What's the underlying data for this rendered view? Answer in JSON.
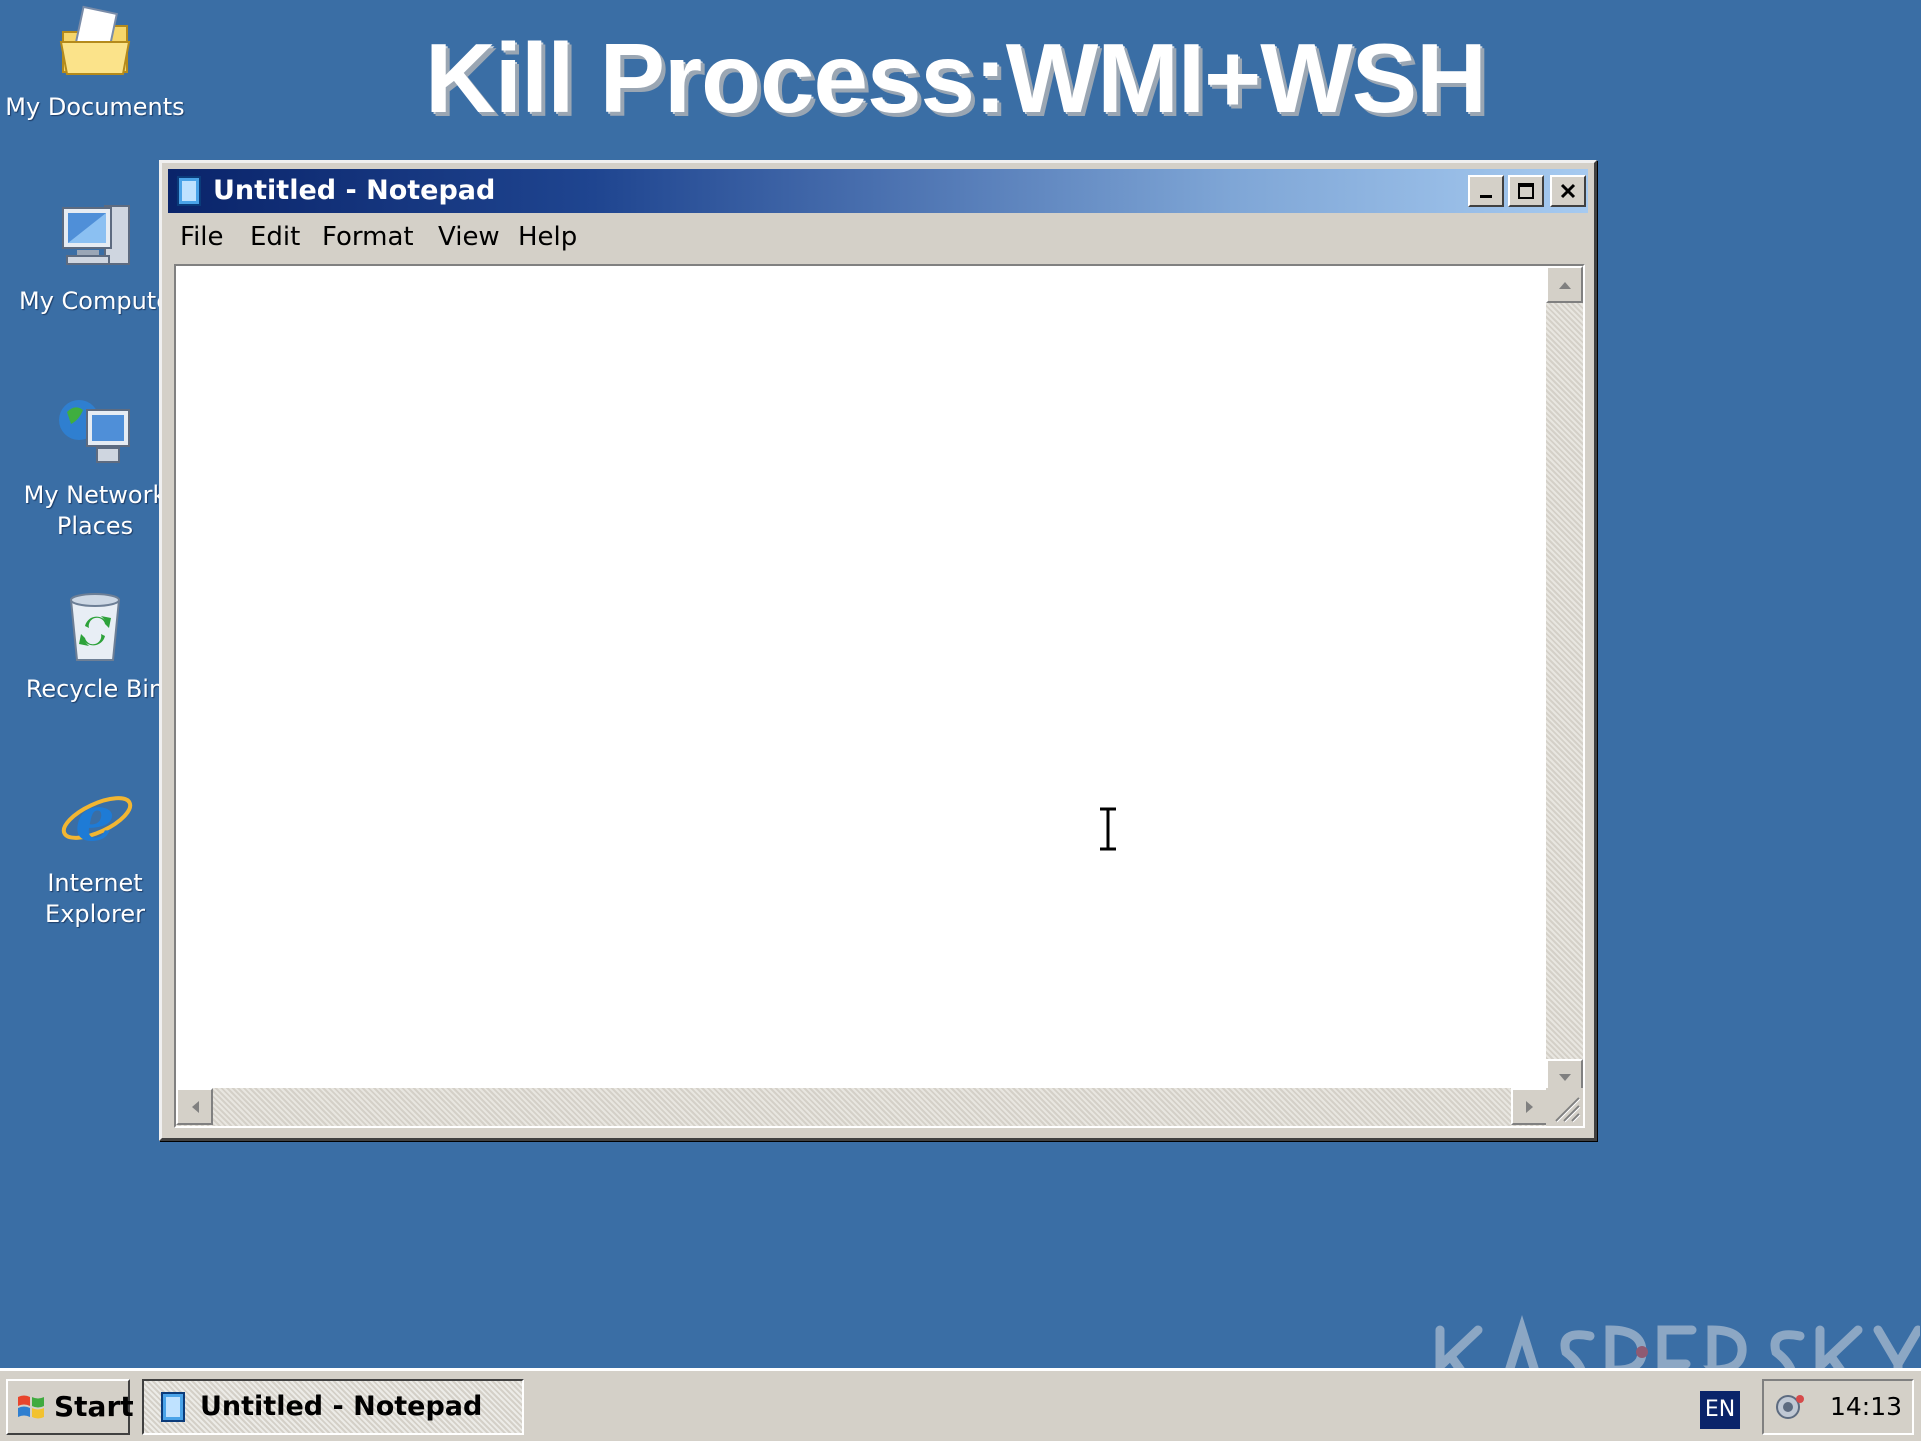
{
  "slide": {
    "title": "Kill Process:WMI+WSH"
  },
  "desktop": {
    "icons": [
      {
        "label": "My Documents",
        "icon": "my-documents-icon"
      },
      {
        "label": "My Compute",
        "icon": "my-computer-icon"
      },
      {
        "label": "My Network\nPlaces",
        "icon": "my-network-places-icon"
      },
      {
        "label": "Recycle Bin",
        "icon": "recycle-bin-icon"
      },
      {
        "label": "Internet\nExplorer",
        "icon": "internet-explorer-icon"
      }
    ]
  },
  "window": {
    "title": "Untitled - Notepad",
    "menu": [
      "File",
      "Edit",
      "Format",
      "View",
      "Help"
    ],
    "content": ""
  },
  "taskbar": {
    "start_label": "Start",
    "task_label": "Untitled - Notepad",
    "language": "EN",
    "clock": "14:13"
  },
  "colors": {
    "desktop": "#3a6ea5",
    "titlebar_start": "#0a246a",
    "titlebar_end": "#a6caf0",
    "chrome": "#d4d0c8"
  }
}
